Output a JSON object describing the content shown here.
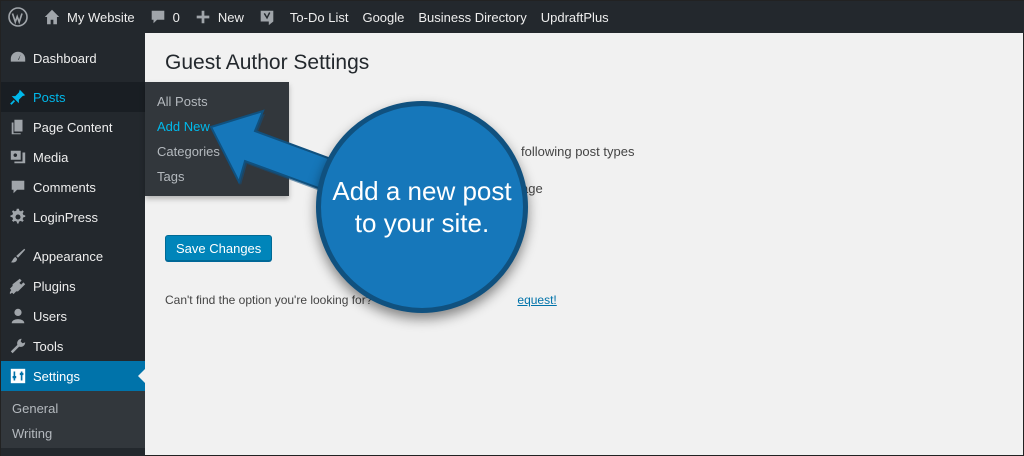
{
  "adminbar": {
    "site_name": "My Website",
    "comments_count": "0",
    "new_label": "New",
    "links": [
      "To-Do List",
      "Google",
      "Business Directory",
      "UpdraftPlus"
    ]
  },
  "sidebar": {
    "items": [
      {
        "label": "Dashboard",
        "icon": "dashboard-icon"
      },
      {
        "label": "Posts",
        "icon": "pin-icon"
      },
      {
        "label": "Page Content",
        "icon": "pages-icon"
      },
      {
        "label": "Media",
        "icon": "media-icon"
      },
      {
        "label": "Comments",
        "icon": "comment-icon"
      },
      {
        "label": "LoginPress",
        "icon": "gear-icon"
      },
      {
        "label": "Appearance",
        "icon": "brush-icon"
      },
      {
        "label": "Plugins",
        "icon": "plug-icon"
      },
      {
        "label": "Users",
        "icon": "user-icon"
      },
      {
        "label": "Tools",
        "icon": "wrench-icon"
      },
      {
        "label": "Settings",
        "icon": "settings-icon"
      }
    ],
    "settings_submenu": [
      "General",
      "Writing"
    ]
  },
  "posts_flyout": [
    "All Posts",
    "Add New",
    "Categories",
    "Tags"
  ],
  "main": {
    "title": "Guest Author Settings",
    "option_fragment_1": "following post types",
    "option_fragment_2": "age",
    "save_label": "Save Changes",
    "help_prefix": "Can't find the option you're looking for?",
    "help_link": "equest!"
  },
  "callout": {
    "text": "Add a new post to your site.",
    "color": "#1677ba"
  },
  "colors": {
    "adminbar_bg": "#23282d",
    "accent": "#0073aa",
    "active_link": "#00b9eb"
  }
}
